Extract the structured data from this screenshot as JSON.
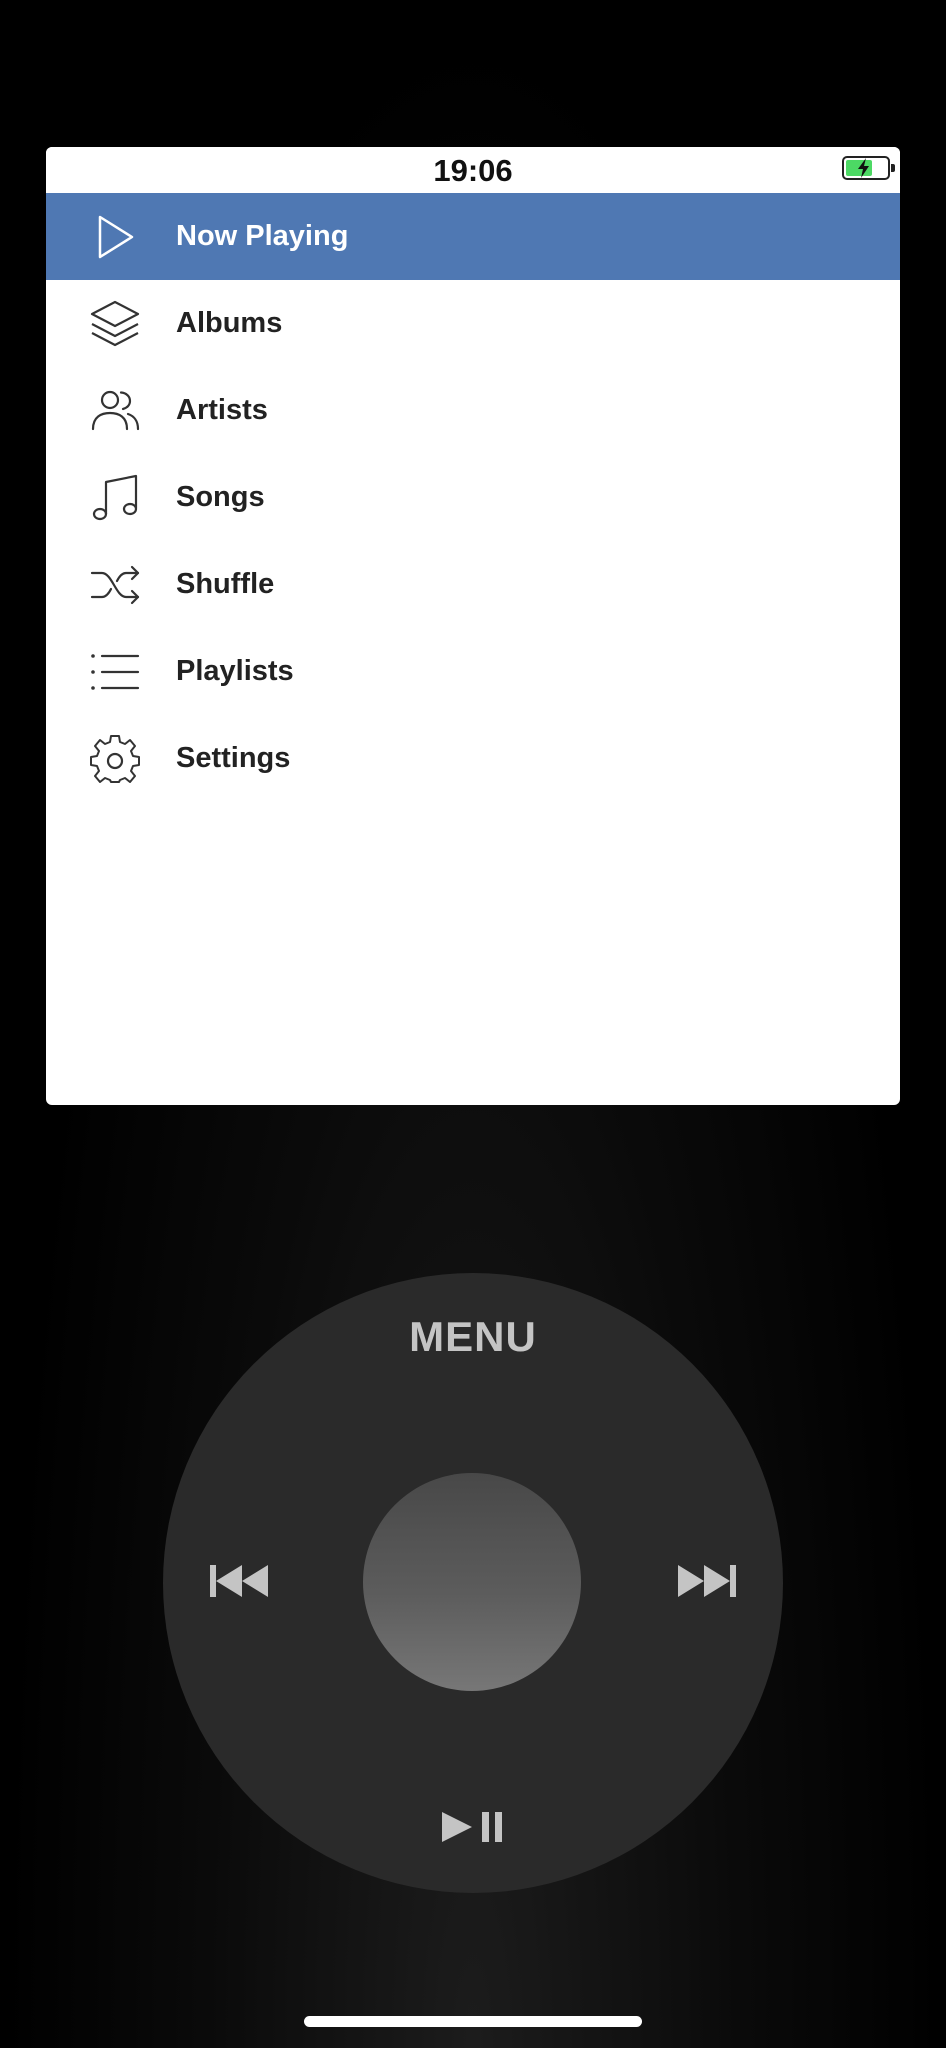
{
  "status_bar": {
    "time": "19:06",
    "battery_icon": "battery-charging-icon"
  },
  "menu": {
    "items": [
      {
        "label": "Now Playing",
        "icon": "play-icon",
        "selected": true
      },
      {
        "label": "Albums",
        "icon": "layers-icon",
        "selected": false
      },
      {
        "label": "Artists",
        "icon": "users-icon",
        "selected": false
      },
      {
        "label": "Songs",
        "icon": "music-note-icon",
        "selected": false
      },
      {
        "label": "Shuffle",
        "icon": "shuffle-icon",
        "selected": false
      },
      {
        "label": "Playlists",
        "icon": "list-icon",
        "selected": false
      },
      {
        "label": "Settings",
        "icon": "gear-icon",
        "selected": false
      }
    ]
  },
  "click_wheel": {
    "menu_label": "MENU",
    "prev_icon": "previous-track-icon",
    "next_icon": "next-track-icon",
    "play_pause_icon": "play-pause-icon",
    "center_icon": "center-select-button"
  },
  "colors": {
    "selected_row": "#4f78b3",
    "wheel": "#2a2a2a",
    "wheel_text": "#c4c4c4",
    "battery_fill": "#4cd964"
  }
}
